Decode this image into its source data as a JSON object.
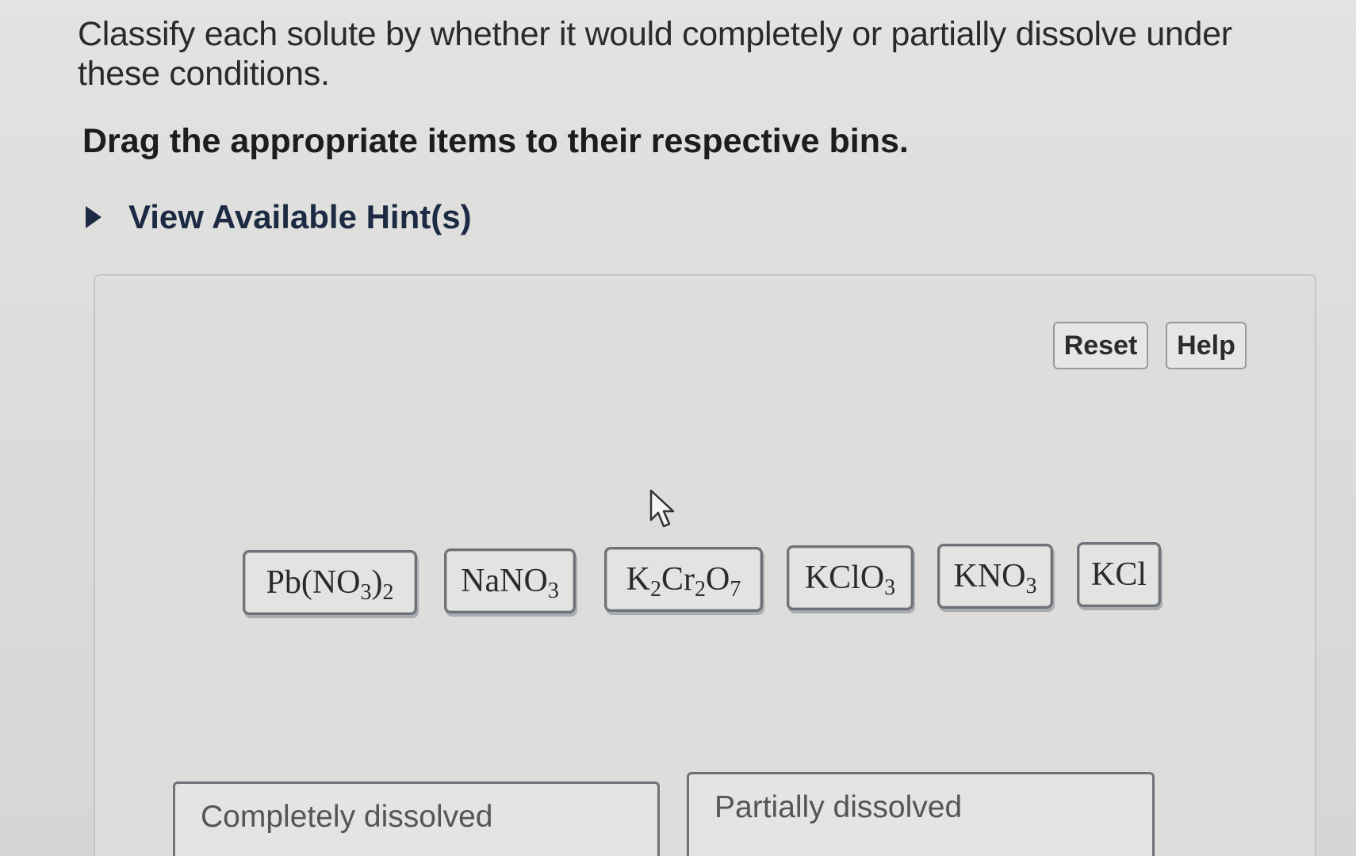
{
  "question": {
    "text": "Classify each solute by whether it would completely or partially dissolve under these conditions.",
    "instruction": "Drag the appropriate items to their respective bins."
  },
  "hints": {
    "label": "View Available Hint(s)"
  },
  "toolbar": {
    "reset_label": "Reset",
    "help_label": "Help"
  },
  "items": [
    {
      "base": "Pb(NO",
      "sub1": "3",
      "mid": ")",
      "sub2": "2"
    },
    {
      "base": "NaNO",
      "sub1": "3"
    },
    {
      "p1": "K",
      "s1": "2",
      "p2": "Cr",
      "s2": "2",
      "p3": "O",
      "s3": "7"
    },
    {
      "base": "KClO",
      "sub1": "3"
    },
    {
      "base": "KNO",
      "sub1": "3"
    },
    {
      "base": "KCl"
    }
  ],
  "bins": {
    "complete_label": "Completely dissolved",
    "partial_label": "Partially dissolved"
  },
  "icons": {
    "hint_toggle": "triangle-right-icon",
    "pointer": "mouse-pointer-icon"
  },
  "colors": {
    "hint_link": "#1c2a44",
    "tile_border": "#6d7278"
  }
}
